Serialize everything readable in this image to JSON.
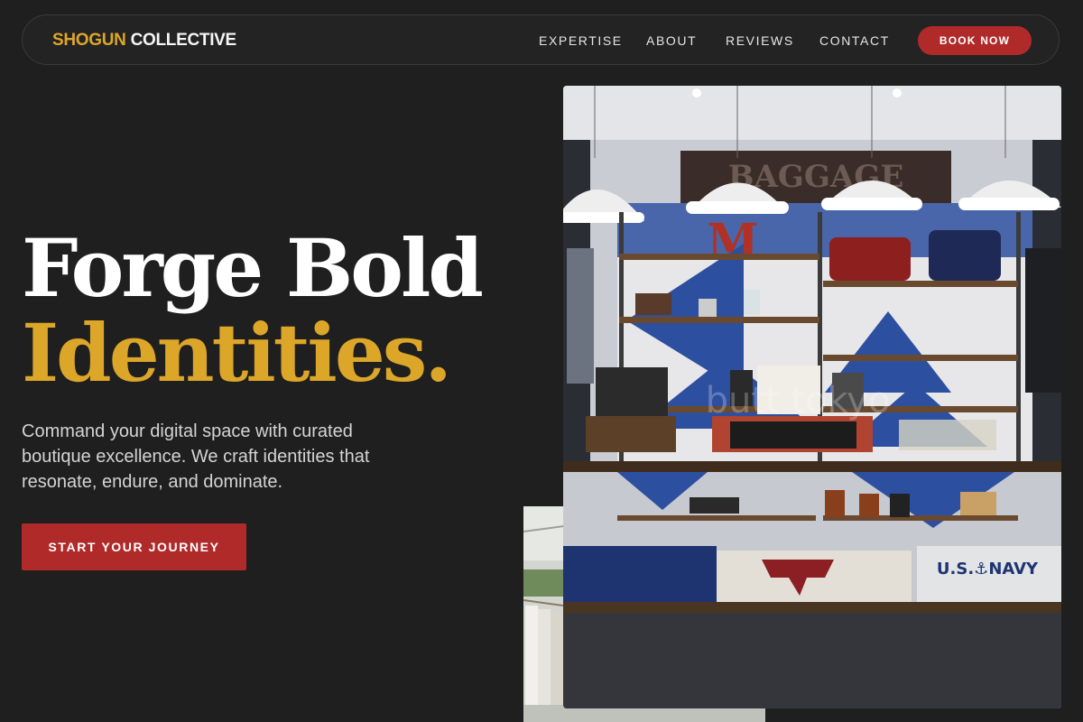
{
  "brand": {
    "part1": "SHOGUN",
    "part2": "COLLECTIVE"
  },
  "nav": {
    "items": [
      {
        "label": "EXPERTISE"
      },
      {
        "label": "ABOUT"
      },
      {
        "label": "REVIEWS"
      },
      {
        "label": "CONTACT"
      }
    ],
    "cta_label": "BOOK NOW"
  },
  "hero": {
    "title_line1": "Forge Bold",
    "title_line2": "Identities.",
    "description": "Command your digital space with curated boutique excellence. We craft identities that resonate, endure, and dominate.",
    "cta_label": "START YOUR JOURNEY"
  },
  "photos": {
    "main_sign_text": "BAGGAGE",
    "main_letter": "M",
    "shirt_text": "U.S.⚓NAVY",
    "watermark": "butt tokyo"
  },
  "colors": {
    "background": "#1f1f1f",
    "accent_gold": "#dca629",
    "accent_red": "#b02a2a",
    "nav_border": "#3a3a3a"
  }
}
